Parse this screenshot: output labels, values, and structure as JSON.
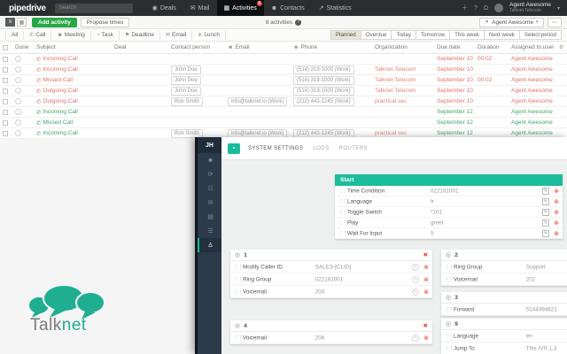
{
  "topnav": {
    "logo": "pipedrive",
    "search_placeholder": "Search",
    "items": [
      {
        "label": "Deals",
        "icon": "deals-icon",
        "glyph": "◉"
      },
      {
        "label": "Mail",
        "icon": "mail-icon",
        "glyph": "✉"
      },
      {
        "label": "Activities",
        "icon": "activities-icon",
        "glyph": "▦",
        "active": true,
        "badge": "8"
      },
      {
        "label": "Contacts",
        "icon": "contacts-icon",
        "glyph": "☻"
      },
      {
        "label": "Statistics",
        "icon": "statistics-icon",
        "glyph": "↗"
      }
    ],
    "user": {
      "name": "Agent Awesome",
      "subtitle": "Talknet Telecom"
    }
  },
  "toolbar": {
    "add_activity": "Add activity",
    "propose_times": "Propose times",
    "count": "8 activities",
    "owner_filter": "Agent Awesome",
    "more": "⋯"
  },
  "filters": {
    "types": [
      {
        "label": "All",
        "icon": "",
        "glyph": ""
      },
      {
        "label": "Call",
        "icon": "call-icon",
        "glyph": "✆"
      },
      {
        "label": "Meeting",
        "icon": "meeting-icon",
        "glyph": "☻"
      },
      {
        "label": "Task",
        "icon": "task-clock-icon",
        "glyph": "◔"
      },
      {
        "label": "Deadline",
        "icon": "deadline-flag-icon",
        "glyph": "⚑"
      },
      {
        "label": "Email",
        "icon": "email-icon",
        "glyph": "✉"
      },
      {
        "label": "Lunch",
        "icon": "lunch-icon",
        "glyph": "⋔"
      }
    ],
    "periods": [
      "Planned",
      "Overdue",
      "Today",
      "Tomorrow",
      "This week",
      "Next week",
      "Select period"
    ],
    "active_period": "Planned"
  },
  "table": {
    "columns": [
      "Done",
      "Subject",
      "Deal",
      "Contact person",
      "Email",
      "Phone",
      "Organization",
      "Due date",
      "Duration",
      "Assigned to user"
    ],
    "rows": [
      {
        "subject": "Incoming Call",
        "contact": "",
        "email": "",
        "phone": "",
        "org": "",
        "due": "September 10",
        "duration": "00:02",
        "assigned": "Agent Awesome",
        "status": "overdue"
      },
      {
        "subject": "Incoming Call",
        "contact": "John Doe",
        "email": "",
        "phone": "(514) 319-1000 (Work)",
        "org": "Talknet Telecom",
        "due": "September 10",
        "duration": "",
        "assigned": "Agent Awesome",
        "status": "overdue"
      },
      {
        "subject": "Missed Call",
        "contact": "John Doe",
        "email": "",
        "phone": "(514) 319-1000 (Work)",
        "org": "Talknet Telecom",
        "due": "September 10",
        "duration": "00:02",
        "assigned": "Agent Awesome",
        "status": "overdue"
      },
      {
        "subject": "Outgoing Call",
        "contact": "John Doe",
        "email": "",
        "phone": "(514) 319-1000 (Work)",
        "org": "Talknet Telecom",
        "due": "September 10",
        "duration": "",
        "assigned": "Agent Awesome",
        "status": "overdue"
      },
      {
        "subject": "Outgoing Call",
        "contact": "Bob Smith",
        "email": "info@talknet.io (Work)",
        "phone": "(212) 443-1245 (Work)",
        "org": "practical sec",
        "due": "September 10",
        "duration": "",
        "assigned": "Agent Awesome",
        "status": "overdue"
      },
      {
        "subject": "Incoming Call",
        "contact": "",
        "email": "",
        "phone": "",
        "org": "",
        "due": "September 12",
        "duration": "",
        "assigned": "Agent Awesome",
        "status": "planned"
      },
      {
        "subject": "Missed Call",
        "contact": "",
        "email": "",
        "phone": "",
        "org": "",
        "due": "September 12",
        "duration": "",
        "assigned": "Agent Awesome",
        "status": "planned"
      },
      {
        "subject": "Incoming Call",
        "contact": "Bob Smith",
        "email": "info@talknet.io (Work)",
        "phone": "(212) 443-1245 (Work)",
        "org": "practical sec",
        "due": "September 12",
        "duration": "",
        "assigned": "Agent Awesome",
        "status": "planned"
      }
    ]
  },
  "overlay": {
    "avatar": "JH",
    "sidebar_icons": [
      {
        "name": "user-icon",
        "glyph": "☻"
      },
      {
        "name": "refresh-icon",
        "glyph": "⟳"
      },
      {
        "name": "team-icon",
        "glyph": "☷"
      },
      {
        "name": "mail-icon",
        "glyph": "✉"
      },
      {
        "name": "card-icon",
        "glyph": "▤"
      },
      {
        "name": "queues-icon",
        "glyph": "☰"
      },
      {
        "name": "ivr-workstation-icon",
        "glyph": "♙",
        "active": true
      }
    ],
    "tabs": [
      "SYSTEM SETTINGS",
      "LOGS",
      "ROUTERS"
    ],
    "active_tab": "SYSTEM SETTINGS",
    "start_card": {
      "title": "Start",
      "rows": [
        {
          "label": "Time Condition",
          "value": "022181001"
        },
        {
          "label": "Language",
          "value": "fr"
        },
        {
          "label": "Toggle Switch",
          "value": "*101"
        },
        {
          "label": "Play",
          "value": "greet"
        },
        {
          "label": "Wait For Input",
          "value": "5"
        }
      ]
    },
    "cards": [
      {
        "num": "1",
        "closable": true,
        "rows": [
          {
            "label": "Modify Caller ID",
            "value": "SALES-[CLID]"
          },
          {
            "label": "Ring Group",
            "value": "022181001"
          },
          {
            "label": "Voicemail",
            "value": "204"
          }
        ]
      },
      {
        "num": "2",
        "closable": false,
        "rows": [
          {
            "label": "Ring Group",
            "value": "Support"
          },
          {
            "label": "Voicemail",
            "value": "202"
          }
        ]
      },
      {
        "num": "3",
        "closable": false,
        "rows": [
          {
            "label": "Forward",
            "value": "5144494621"
          }
        ]
      },
      {
        "num": "4",
        "closable": true,
        "rows": [
          {
            "label": "Voicemail",
            "value": "206"
          }
        ]
      },
      {
        "num": "9",
        "closable": false,
        "rows": [
          {
            "label": "Language",
            "value": "en"
          },
          {
            "label": "Jump To",
            "value": "This IVR,1,3"
          }
        ]
      }
    ]
  },
  "brand": {
    "talk": "Talk",
    "net": "net"
  },
  "colors": {
    "accent_teal": "#1abc9c",
    "pipedrive_green": "#28a745",
    "overdue_red": "#e2726e",
    "planned_green": "#46a46c",
    "danger_red": "#e74c3c"
  }
}
